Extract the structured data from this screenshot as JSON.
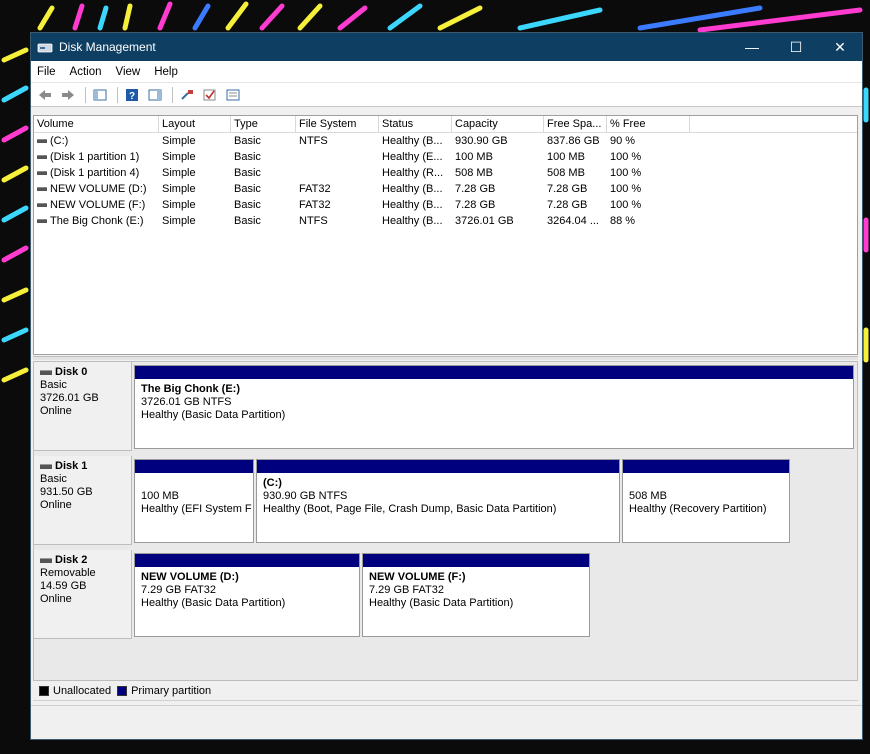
{
  "window": {
    "title": "Disk Management"
  },
  "menu": [
    "File",
    "Action",
    "View",
    "Help"
  ],
  "colors": {
    "titlebar": "#0e3e62",
    "primary_partition": "#00007f",
    "unallocated": "#000000"
  },
  "volume_table": {
    "columns": [
      "Volume",
      "Layout",
      "Type",
      "File System",
      "Status",
      "Capacity",
      "Free Spa...",
      "% Free"
    ],
    "rows": [
      [
        "(C:)",
        "Simple",
        "Basic",
        "NTFS",
        "Healthy (B...",
        "930.90 GB",
        "837.86 GB",
        "90 %"
      ],
      [
        "(Disk 1 partition 1)",
        "Simple",
        "Basic",
        "",
        "Healthy (E...",
        "100 MB",
        "100 MB",
        "100 %"
      ],
      [
        "(Disk 1 partition 4)",
        "Simple",
        "Basic",
        "",
        "Healthy (R...",
        "508 MB",
        "508 MB",
        "100 %"
      ],
      [
        "NEW VOLUME (D:)",
        "Simple",
        "Basic",
        "FAT32",
        "Healthy (B...",
        "7.28 GB",
        "7.28 GB",
        "100 %"
      ],
      [
        "NEW VOLUME (F:)",
        "Simple",
        "Basic",
        "FAT32",
        "Healthy (B...",
        "7.28 GB",
        "7.28 GB",
        "100 %"
      ],
      [
        "The Big Chonk (E:)",
        "Simple",
        "Basic",
        "NTFS",
        "Healthy (B...",
        "3726.01 GB",
        "3264.04 ...",
        "88 %"
      ]
    ]
  },
  "disks": [
    {
      "name": "Disk 0",
      "type": "Basic",
      "size": "3726.01 GB",
      "status": "Online",
      "partitions": [
        {
          "label": "The Big Chonk  (E:)",
          "size": "3726.01 GB NTFS",
          "health": "Healthy (Basic Data Partition)"
        }
      ]
    },
    {
      "name": "Disk 1",
      "type": "Basic",
      "size": "931.50 GB",
      "status": "Online",
      "partitions": [
        {
          "label": "",
          "size": "100 MB",
          "health": "Healthy (EFI System F"
        },
        {
          "label": "(C:)",
          "size": "930.90 GB NTFS",
          "health": "Healthy (Boot, Page File, Crash Dump, Basic Data Partition)"
        },
        {
          "label": "",
          "size": "508 MB",
          "health": "Healthy (Recovery Partition)"
        }
      ]
    },
    {
      "name": "Disk 2",
      "type": "Removable",
      "size": "14.59 GB",
      "status": "Online",
      "partitions": [
        {
          "label": "NEW VOLUME  (D:)",
          "size": "7.29 GB FAT32",
          "health": "Healthy (Basic Data Partition)"
        },
        {
          "label": "NEW VOLUME  (F:)",
          "size": "7.29 GB FAT32",
          "health": "Healthy (Basic Data Partition)"
        }
      ]
    }
  ],
  "legend": {
    "unallocated": "Unallocated",
    "primary": "Primary partition"
  }
}
